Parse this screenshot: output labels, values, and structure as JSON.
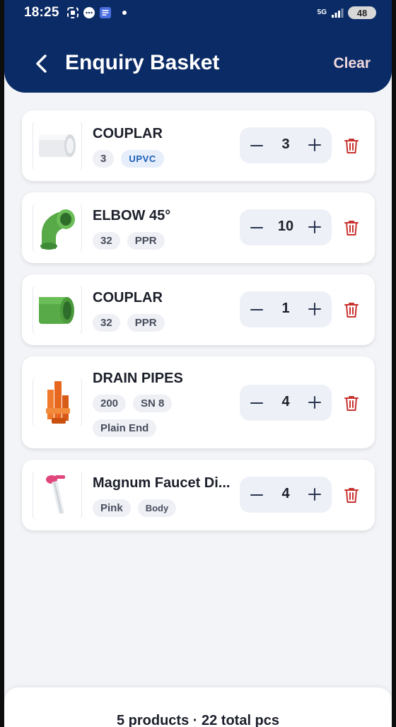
{
  "status_bar": {
    "time": "18:25",
    "network": "5G",
    "battery": "48"
  },
  "header": {
    "title": "Enquiry Basket",
    "clear_label": "Clear"
  },
  "items": [
    {
      "name": "COUPLAR",
      "chips": [
        "3",
        "UPVC"
      ],
      "quantity": "3",
      "image": "white-upvc-coupler"
    },
    {
      "name": "ELBOW 45°",
      "chips": [
        "32",
        "PPR"
      ],
      "quantity": "10",
      "image": "green-ppr-elbow"
    },
    {
      "name": "COUPLAR",
      "chips": [
        "32",
        "PPR"
      ],
      "quantity": "1",
      "image": "green-ppr-coupler"
    },
    {
      "name": "DRAIN PIPES",
      "chips": [
        "200",
        "SN 8",
        "Plain End"
      ],
      "quantity": "4",
      "image": "orange-drain-pipes"
    },
    {
      "name": "Magnum Faucet Di...",
      "chips": [
        "Pink",
        "Body"
      ],
      "quantity": "4",
      "image": "pink-faucet-diverter"
    }
  ],
  "footer": {
    "summary": "5 products · 22 total pcs"
  },
  "colors": {
    "header_bg": "#0b2b66",
    "delete_red": "#c8322f",
    "upvc_chip_text": "#1b5fb5"
  }
}
